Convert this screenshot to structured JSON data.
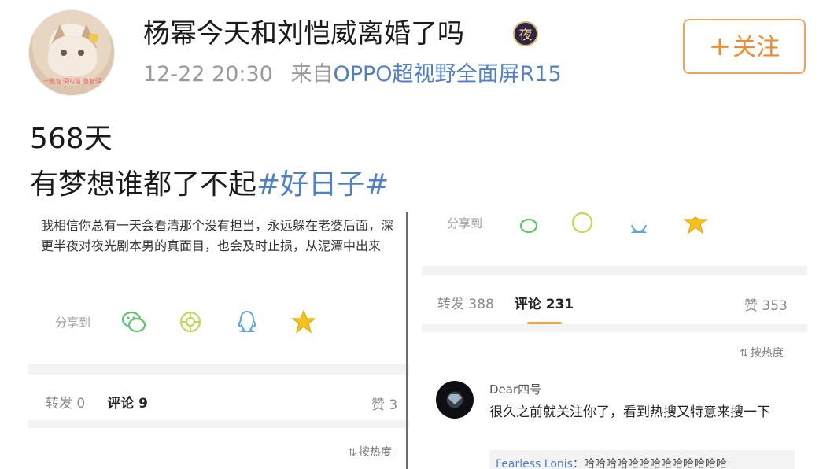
{
  "post": {
    "username": "杨幂今天和刘恺威离婚了吗",
    "vip_badge": "夜",
    "timestamp": "12-22 20:30",
    "source_prefix": "来自",
    "source_device": "OPPO超视野全面屏R15",
    "follow_label": "关注",
    "follow_plus": "+",
    "avatar_caption": "一鲁智深的猫 鲁智深",
    "line1": "568天",
    "line2_text": "有梦想谁都了不起",
    "line2_hashtag": "#好日子#"
  },
  "left_shot": {
    "quote": "我相信你总有一天会看清那个没有担当，永远躲在老婆后面，深更半夜对夜光剧本男的真面目，也会及时止损，从泥潭中出来",
    "share_label": "分享到",
    "share_icons": [
      "wechat-icon",
      "moments-icon",
      "qq-icon",
      "qzone-star-icon"
    ],
    "tabs": {
      "repost": "转发 0",
      "comment": "评论 9",
      "like": "赞 3"
    },
    "sort_label": "按热度",
    "sort_icon": "⇅"
  },
  "right_shot": {
    "share_label": "分享到",
    "tabs": {
      "repost": "转发 388",
      "comment": "评论 231",
      "like": "赞 353"
    },
    "sort_label": "按热度",
    "sort_icon": "⇅",
    "comment": {
      "author": "Dear四号",
      "text": "很久之前就关注你了，看到热搜又特意来搜一下",
      "reply_author": "Fearless Lonis",
      "reply_text": "：哈哈哈哈哈哈哈哈哈哈哈哈哈"
    }
  },
  "colors": {
    "link_blue": "#4f7fc6",
    "follow_orange": "#f08a2a",
    "tab_underline": "#f0a340",
    "wechat_green": "#5cc56a",
    "moments_yellow_green": "#c8d35a",
    "qq_blue": "#5aa7e6",
    "qzone_yellow": "#f4c21f"
  }
}
